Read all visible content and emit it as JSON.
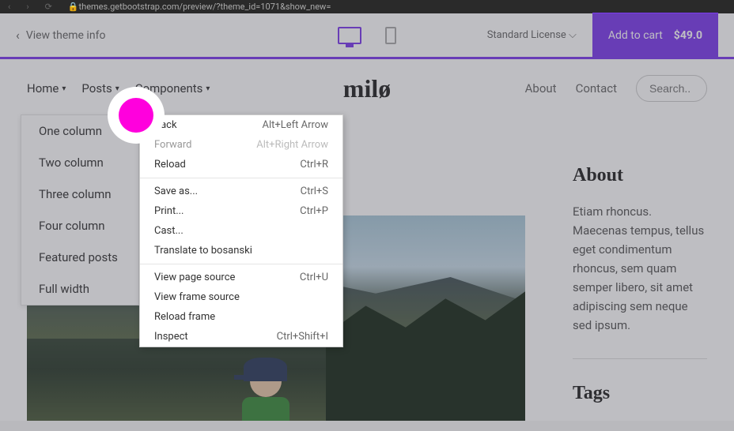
{
  "browser": {
    "url": "themes.getbootstrap.com/preview/?theme_id=1071&show_new="
  },
  "theme_bar": {
    "view_theme": "View theme info",
    "license": "Standard License",
    "add_to_cart": "Add to cart",
    "price": "$49.0"
  },
  "nav": {
    "items": [
      "Home",
      "Posts",
      "Components"
    ],
    "right": [
      "About",
      "Contact"
    ],
    "search_placeholder": "Search.."
  },
  "logo": "milø",
  "home_dropdown": {
    "items": [
      "One column",
      "Two column",
      "Three column",
      "Four column",
      "Featured posts",
      "Full width"
    ]
  },
  "context_menu": {
    "groups": [
      [
        {
          "label": "Back",
          "shortcut": "Alt+Left Arrow",
          "disabled": false
        },
        {
          "label": "Forward",
          "shortcut": "Alt+Right Arrow",
          "disabled": true
        },
        {
          "label": "Reload",
          "shortcut": "Ctrl+R",
          "disabled": false
        }
      ],
      [
        {
          "label": "Save as...",
          "shortcut": "Ctrl+S",
          "disabled": false
        },
        {
          "label": "Print...",
          "shortcut": "Ctrl+P",
          "disabled": false
        },
        {
          "label": "Cast...",
          "shortcut": "",
          "disabled": false
        },
        {
          "label": "Translate to bosanski",
          "shortcut": "",
          "disabled": false
        }
      ],
      [
        {
          "label": "View page source",
          "shortcut": "Ctrl+U",
          "disabled": false
        },
        {
          "label": "View frame source",
          "shortcut": "",
          "disabled": false
        },
        {
          "label": "Reload frame",
          "shortcut": "",
          "disabled": false
        },
        {
          "label": "Inspect",
          "shortcut": "Ctrl+Shift+I",
          "disabled": false
        }
      ]
    ]
  },
  "sidebar": {
    "about_title": "About",
    "about_text": "Etiam rhoncus. Maecenas tempus, tellus eget condimentum rhoncus, sem quam semper libero, sit amet adipiscing sem neque sed ipsum.",
    "tags_title": "Tags"
  }
}
